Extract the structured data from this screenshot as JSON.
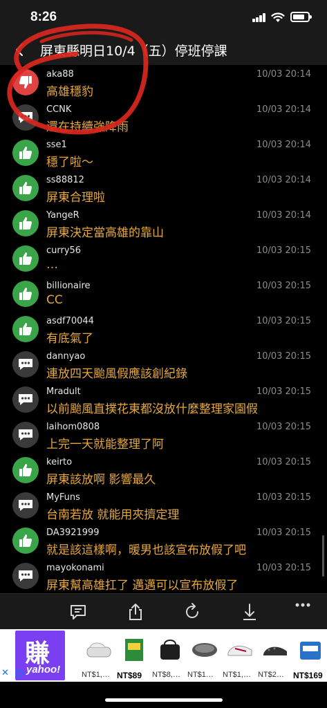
{
  "status": {
    "time": "8:26"
  },
  "header": {
    "title": "屏東縣明日10/4（五）停班停課"
  },
  "comments": [
    {
      "user": "aka88",
      "time": "10/03 20:14",
      "text": "高雄穩豹",
      "vote": "down"
    },
    {
      "user": "CCNK",
      "time": "10/03 20:14",
      "text": "還在持續強降雨",
      "vote": "neutral"
    },
    {
      "user": "sse1",
      "time": "10/03 20:14",
      "text": "穩了啦～",
      "vote": "up"
    },
    {
      "user": "ss88812",
      "time": "10/03 20:14",
      "text": "屏東合理啦",
      "vote": "up"
    },
    {
      "user": "YangeR",
      "time": "10/03 20:14",
      "text": "屏東決定當高雄的靠山",
      "vote": "up"
    },
    {
      "user": "curry56",
      "time": "10/03 20:15",
      "text": "…",
      "vote": "up"
    },
    {
      "user": "billionaire",
      "time": "10/03 20:15",
      "text": "CC",
      "vote": "up"
    },
    {
      "user": "asdf70044",
      "time": "10/03 20:15",
      "text": "有底氣了",
      "vote": "up"
    },
    {
      "user": "dannyao",
      "time": "10/03 20:15",
      "text": "連放四天颱風假應該創紀錄",
      "vote": "neutral"
    },
    {
      "user": "Mradult",
      "time": "10/03 20:15",
      "text": "以前颱風直撲花東都沒放什麼整理家園假",
      "vote": "neutral"
    },
    {
      "user": "laihom0808",
      "time": "10/03 20:15",
      "text": "上完一天就能整理了阿",
      "vote": "neutral"
    },
    {
      "user": "keirto",
      "time": "10/03 20:15",
      "text": "屏東該放啊 影響最久",
      "vote": "up"
    },
    {
      "user": "MyFuns",
      "time": "10/03 20:15",
      "text": "台南若放 就能用夾擠定理",
      "vote": "neutral"
    },
    {
      "user": "DA3921999",
      "time": "10/03 20:15",
      "text": "就是該這樣啊，暖男也該宣布放假了吧",
      "vote": "up"
    },
    {
      "user": "mayokonami",
      "time": "10/03 20:15",
      "text": "屏東幫高雄扛了 邁邁可以宣布放假了",
      "vote": "neutral"
    }
  ],
  "toolbar": {
    "icons": [
      "comment-icon",
      "share-icon",
      "refresh-icon",
      "download-icon",
      "more-icon"
    ]
  },
  "ad": {
    "logo_char": "賺",
    "logo_text": "yahoo!",
    "close": "✕",
    "items": [
      {
        "price": "NT$1,…",
        "bold": false
      },
      {
        "price": "NT$89",
        "bold": true
      },
      {
        "price": "NT$8,…",
        "bold": false
      },
      {
        "price": "NT$1…",
        "bold": false
      },
      {
        "price": "NT$1,…",
        "bold": false
      },
      {
        "price": "NT$2…",
        "bold": false
      },
      {
        "price": "NT$169",
        "bold": true
      }
    ]
  },
  "colors": {
    "up": "#3aa548",
    "down": "#e04343",
    "neutral": "#3a3a3a",
    "message": "#e6a83a",
    "annotation": "#d9271e"
  }
}
